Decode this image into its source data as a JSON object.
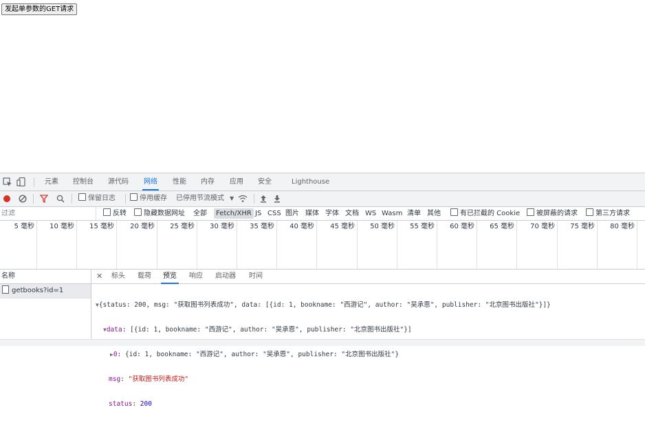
{
  "page": {
    "button_label": "发起单参数的GET请求"
  },
  "devtools": {
    "tabs": [
      "元素",
      "控制台",
      "源代码",
      "网络",
      "性能",
      "内存",
      "应用",
      "安全",
      "Lighthouse"
    ],
    "active_tab": "网络",
    "toolbar": {
      "preserve_log": "保留日志",
      "disable_cache": "停用缓存",
      "throttling": "已停用节流模式"
    },
    "filter": {
      "placeholder": "过滤",
      "invert": "反转",
      "hide_data_urls": "隐藏数据网址",
      "types": [
        "全部",
        "Fetch/XHR",
        "JS",
        "CSS",
        "图片",
        "媒体",
        "字体",
        "文档",
        "WS",
        "Wasm",
        "清单",
        "其他"
      ],
      "selected_type": "Fetch/XHR",
      "blocked_cookies": "有已拦截的 Cookie",
      "blocked_requests": "被屏蔽的请求",
      "third_party": "第三方请求"
    },
    "timeline_labels": [
      "5 毫秒",
      "10 毫秒",
      "15 毫秒",
      "20 毫秒",
      "25 毫秒",
      "30 毫秒",
      "35 毫秒",
      "40 毫秒",
      "45 毫秒",
      "50 毫秒",
      "55 毫秒",
      "60 毫秒",
      "65 毫秒",
      "70 毫秒",
      "75 毫秒",
      "80 毫秒"
    ],
    "names": {
      "header": "名称",
      "rows": [
        "getbooks?id=1"
      ]
    },
    "details": {
      "tabs": [
        "标头",
        "载荷",
        "预览",
        "响应",
        "启动器",
        "时间"
      ],
      "active_tab": "预览",
      "preview": {
        "line1": "{status: 200, msg: \"获取图书列表成功\", data: [{id: 1, bookname: \"西游记\", author: \"吴承恩\", publisher: \"北京图书出版社\"}]}",
        "line2_key": "data",
        "line2_val": ": [{id: 1, bookname: \"西游记\", author: \"吴承恩\", publisher: \"北京图书出版社\"}]",
        "line3_key": "0",
        "line3_val": ": {id: 1, bookname: \"西游记\", author: \"吴承恩\", publisher: \"北京图书出版社\"}",
        "line4_key": "msg",
        "line4_val": "\"获取图书列表成功\"",
        "line5_key": "status",
        "line5_val": "200"
      }
    }
  },
  "colors": {
    "accent": "#1a73e8",
    "record": "#d93025",
    "filter_icon": "#d93025"
  }
}
